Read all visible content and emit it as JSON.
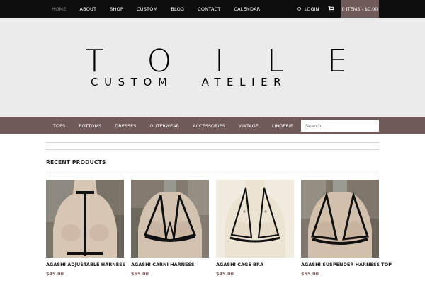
{
  "top_nav": {
    "items": [
      {
        "label": "HOME"
      },
      {
        "label": "ABOUT"
      },
      {
        "label": "SHOP"
      },
      {
        "label": "CUSTOM"
      },
      {
        "label": "BLOG"
      },
      {
        "label": "CONTACT"
      },
      {
        "label": "CALENDAR"
      }
    ],
    "login_label": "LOGIN",
    "cart_label": "0 ITEMS - $0.00"
  },
  "header": {
    "logo_letters": [
      "T",
      "O",
      "I",
      "L",
      "E"
    ],
    "logo_subtitle": "CUSTOM   ATELIER"
  },
  "category_nav": {
    "items": [
      {
        "label": "TOPS"
      },
      {
        "label": "BOTTOMS"
      },
      {
        "label": "DRESSES"
      },
      {
        "label": "OUTERWEAR"
      },
      {
        "label": "ACCESSORIES"
      },
      {
        "label": "VINTAGE"
      },
      {
        "label": "LINGERIE"
      }
    ],
    "search_placeholder": "Search..."
  },
  "recent_products": {
    "title": "RECENT PRODUCTS",
    "products": [
      {
        "name": "AGASHI ADJUSTABLE HARNESS",
        "price": "$45.00"
      },
      {
        "name": "AGASHI CARNI HARNESS",
        "price": "$65.00"
      },
      {
        "name": "AGASHI CAGE BRA",
        "price": "$45.00"
      },
      {
        "name": "AGASHI SUSPENDER HARNESS TOP",
        "price": "$55.00"
      }
    ]
  },
  "colors": {
    "accent": "#715a5a",
    "topbar": "#0e0e0e",
    "header_bg": "#ebebeb",
    "price": "#8a6b6b"
  }
}
